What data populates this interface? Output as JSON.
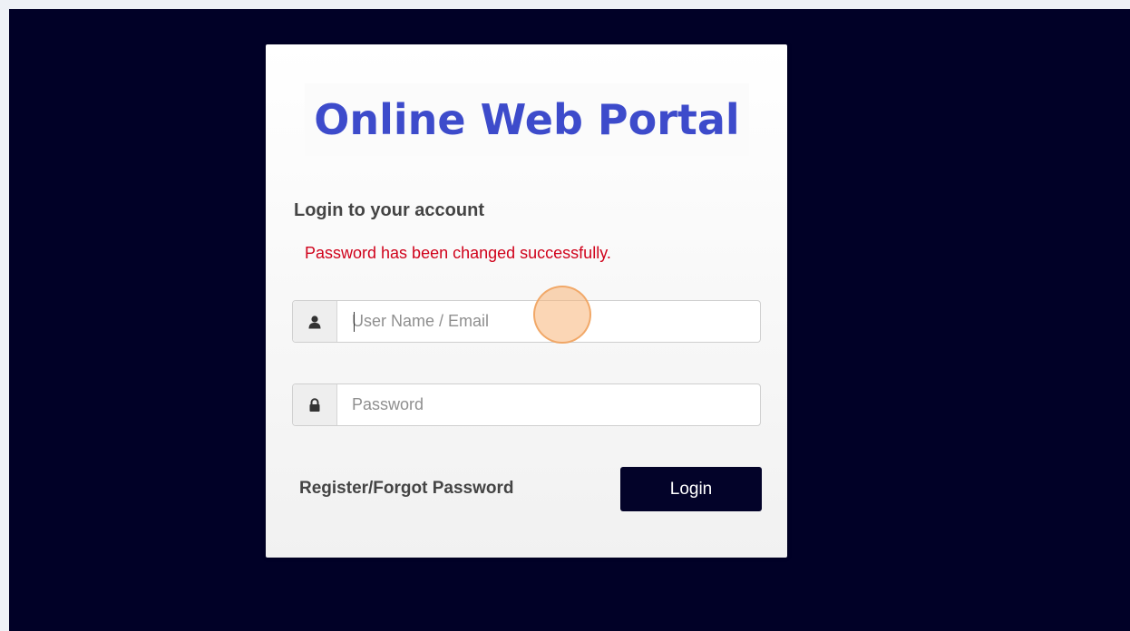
{
  "logo": {
    "text": "Online Web Portal"
  },
  "login": {
    "heading": "Login to your account",
    "message": "Password has been changed successfully.",
    "username_placeholder": "User Name / Email",
    "username_value": "",
    "password_placeholder": "Password",
    "password_value": "",
    "register_label": "Register/Forgot Password",
    "submit_label": "Login"
  },
  "icons": {
    "username": "user-icon",
    "password": "lock-icon"
  },
  "colors": {
    "background": "#010127",
    "logo": "#3d4bcb",
    "message": "#d0021b",
    "button": "#030329"
  }
}
